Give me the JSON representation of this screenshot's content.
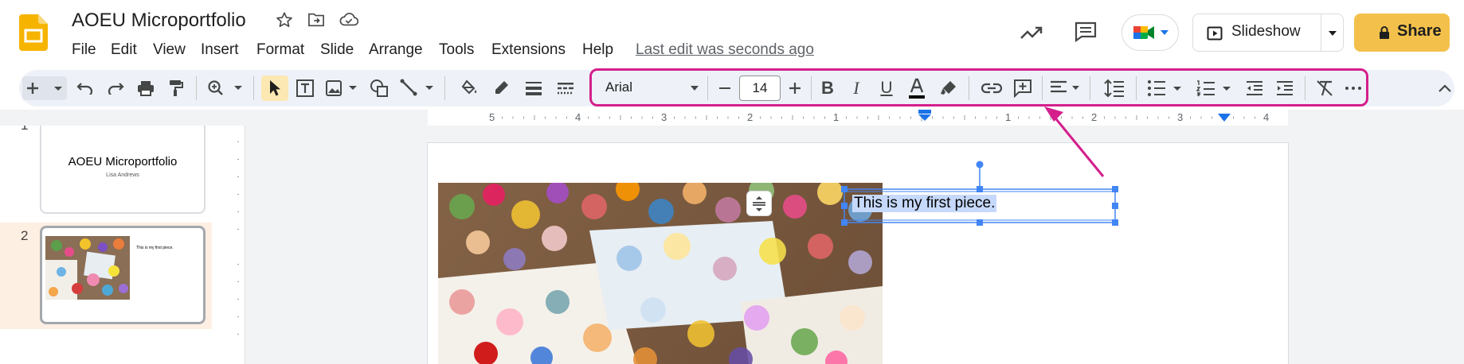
{
  "app": {
    "doc_title": "AOEU Microportfolio",
    "last_edit": "Last edit was seconds ago"
  },
  "menu": [
    "File",
    "Edit",
    "View",
    "Insert",
    "Format",
    "Slide",
    "Arrange",
    "Tools",
    "Extensions",
    "Help"
  ],
  "header": {
    "slideshow_label": "Slideshow",
    "share_label": "Share"
  },
  "toolbar": {
    "font_name": "Arial",
    "font_size": "14"
  },
  "ruler": {
    "labels": [
      "5",
      "4",
      "3",
      "2",
      "1",
      "",
      "1",
      "2",
      "3",
      "4"
    ]
  },
  "slides": [
    {
      "number": "1",
      "title": "AOEU Microportfolio",
      "subtitle": "Lisa Andrews"
    },
    {
      "number": "2",
      "caption": "This is my first piece."
    }
  ],
  "canvas": {
    "textbox_text": "This is my first piece."
  },
  "colors": {
    "accent": "#1a73e8",
    "annotation": "#d41f8c",
    "share": "#f3c14b",
    "toolbar_bg": "#eef2f8"
  },
  "icons": [
    "slides-logo-icon",
    "star-icon",
    "move-folder-icon",
    "cloud-saved-icon",
    "trend-icon",
    "comment-icon",
    "meet-icon",
    "present-icon",
    "lock-icon"
  ]
}
